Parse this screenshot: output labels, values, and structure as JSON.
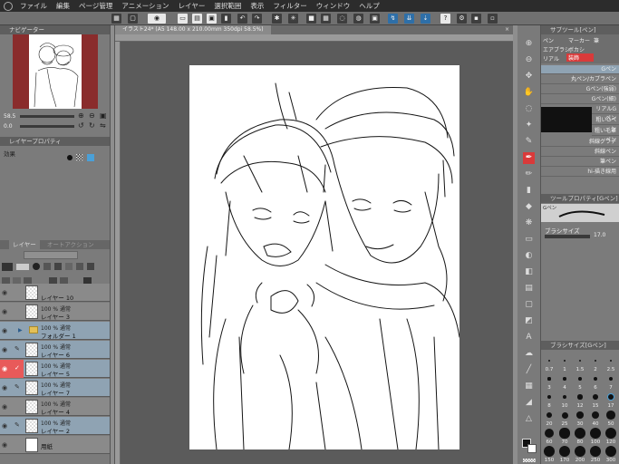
{
  "menu": [
    "ファイル",
    "編集",
    "ページ管理",
    "アニメーション",
    "レイヤー",
    "選択範囲",
    "表示",
    "フィルター",
    "ウィンドウ",
    "ヘルプ"
  ],
  "document_tab": "イラスト24* (A5 148.00 x 210.00mm 350dpi 58.5%)",
  "navigator": {
    "title": "ナビゲーター",
    "zoom": "58.5",
    "angle": "0.0"
  },
  "layer_property": {
    "title": "レイヤープロパティ",
    "effect_label": "効果"
  },
  "layer_panel": {
    "tab1": "レイヤー",
    "tab2": "オートアクション"
  },
  "layers": [
    {
      "mode": "",
      "name": "レイヤー 10",
      "visible": true,
      "selected": false,
      "folder": false
    },
    {
      "mode": "100 % 通常",
      "name": "レイヤー 3",
      "visible": true,
      "selected": false,
      "folder": false
    },
    {
      "mode": "100 % 通常",
      "name": "フォルダー 1",
      "visible": true,
      "selected": true,
      "folder": true
    },
    {
      "mode": "100 % 通常",
      "name": "レイヤー 6",
      "visible": true,
      "selected": true,
      "folder": false
    },
    {
      "mode": "100 % 通常",
      "name": "レイヤー 5",
      "visible": true,
      "selected": true,
      "folder": false,
      "active": true
    },
    {
      "mode": "100 % 通常",
      "name": "レイヤー 7",
      "visible": true,
      "selected": true,
      "folder": false
    },
    {
      "mode": "100 % 通常",
      "name": "レイヤー 4",
      "visible": true,
      "selected": false,
      "folder": false
    },
    {
      "mode": "100 % 通常",
      "name": "レイヤー 2",
      "visible": true,
      "selected": true,
      "folder": false
    },
    {
      "mode": "",
      "name": "用紙",
      "visible": true,
      "selected": false,
      "folder": false
    }
  ],
  "subtool": {
    "title": "サブツール[ペン]",
    "tabs": [
      "ペン",
      "マーカー",
      "筆",
      "エアブラシ",
      "ボカシ",
      "リアル",
      "装飾"
    ],
    "brushes": [
      "Gペン",
      "丸ペン/カブラペン",
      "Gペン(強弱)",
      "Gペン(細)",
      "リアルGペン",
      "粗いGペン",
      "粗い毛筆ペン",
      "斜線グラデ",
      "斜線ペン",
      "筆ペン",
      "hi-描き線用"
    ]
  },
  "tool_property": {
    "title": "ツールプロパティ[Gペン]",
    "tool_name": "Gペン",
    "brush_size_label": "ブラシサイズ",
    "brush_size_value": "17.0"
  },
  "brush_size_panel": {
    "title": "ブラシサイズ[Gペン]",
    "sizes": [
      "0.7",
      "1",
      "1.5",
      "2",
      "2.5",
      "3",
      "4",
      "5",
      "6",
      "7",
      "8",
      "10",
      "12",
      "15",
      "17",
      "20",
      "25",
      "30",
      "40",
      "50",
      "60",
      "70",
      "80",
      "100",
      "120",
      "150",
      "170",
      "200",
      "250",
      "300"
    ]
  },
  "colors": {
    "accent_red": "#d93a3a",
    "selected_row": "#8fa3b3"
  }
}
